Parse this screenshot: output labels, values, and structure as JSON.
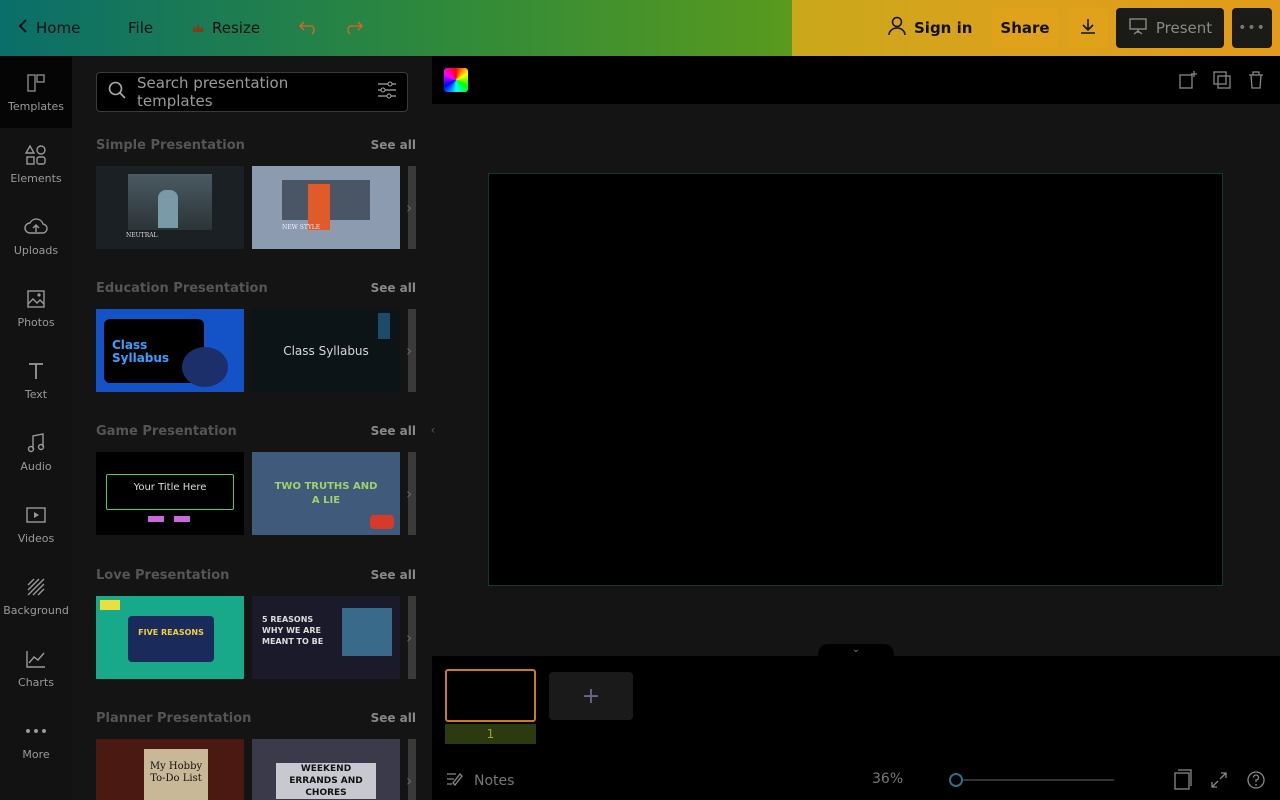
{
  "topbar": {
    "home_label": "Home",
    "file_label": "File",
    "resize_label": "Resize",
    "signin_label": "Sign in",
    "share_label": "Share",
    "present_label": "Present"
  },
  "rail": {
    "items": [
      {
        "label": "Templates"
      },
      {
        "label": "Elements"
      },
      {
        "label": "Uploads"
      },
      {
        "label": "Photos"
      },
      {
        "label": "Text"
      },
      {
        "label": "Audio"
      },
      {
        "label": "Videos"
      },
      {
        "label": "Background"
      },
      {
        "label": "Charts"
      },
      {
        "label": "More"
      }
    ]
  },
  "panel": {
    "search_placeholder": "Search presentation templates",
    "see_all": "See all",
    "sections": [
      {
        "title": "Simple Presentation",
        "thumbs": [
          {
            "text": "NEUTRAL"
          },
          {
            "text": "NEW STYLE"
          }
        ]
      },
      {
        "title": "Education Presentation",
        "thumbs": [
          {
            "text": "Class Syllabus"
          },
          {
            "text": "Class Syllabus"
          }
        ]
      },
      {
        "title": "Game Presentation",
        "thumbs": [
          {
            "text": "Your Title Here"
          },
          {
            "text": "TWO TRUTHS AND A LIE"
          }
        ]
      },
      {
        "title": "Love Presentation",
        "thumbs": [
          {
            "text": "FIVE REASONS"
          },
          {
            "text": "5 REASONS WHY WE ARE MEANT TO BE"
          }
        ]
      },
      {
        "title": "Planner Presentation",
        "thumbs": [
          {
            "text": "My Hobby To-Do List"
          },
          {
            "text": "WEEKEND ERRANDS AND CHORES"
          }
        ]
      }
    ]
  },
  "pages": {
    "current_page": "1"
  },
  "footer": {
    "notes_label": "Notes",
    "zoom": "36%"
  }
}
